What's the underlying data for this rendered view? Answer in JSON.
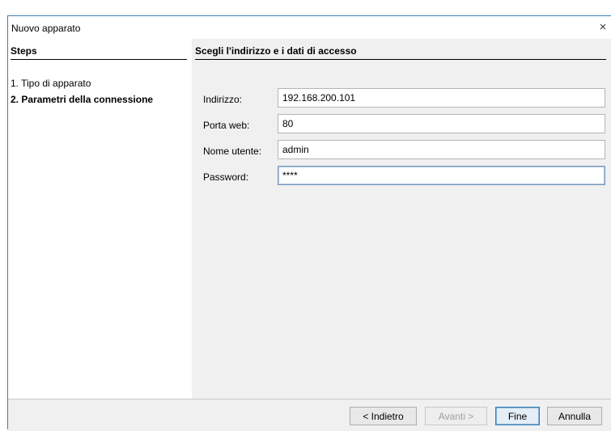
{
  "window": {
    "title": "Nuovo apparato",
    "close_glyph": "×"
  },
  "steps": {
    "header": "Steps",
    "items": [
      {
        "label": "1. Tipo di apparato",
        "current": false
      },
      {
        "label": "2. Parametri della connessione",
        "current": true
      }
    ]
  },
  "content": {
    "header": "Scegli l'indirizzo e i dati di accesso",
    "fields": {
      "address": {
        "label": "Indirizzo:",
        "value": "192.168.200.101"
      },
      "port": {
        "label": "Porta web:",
        "value": "80"
      },
      "username": {
        "label": "Nome utente:",
        "value": "admin"
      },
      "password": {
        "label": "Password:",
        "value": "****"
      }
    }
  },
  "buttons": {
    "back": "< Indietro",
    "next": "Avanti >",
    "finish": "Fine",
    "cancel": "Annulla"
  },
  "colors": {
    "window_border": "#3c7fb1",
    "panel_background": "#f0f0f0"
  }
}
